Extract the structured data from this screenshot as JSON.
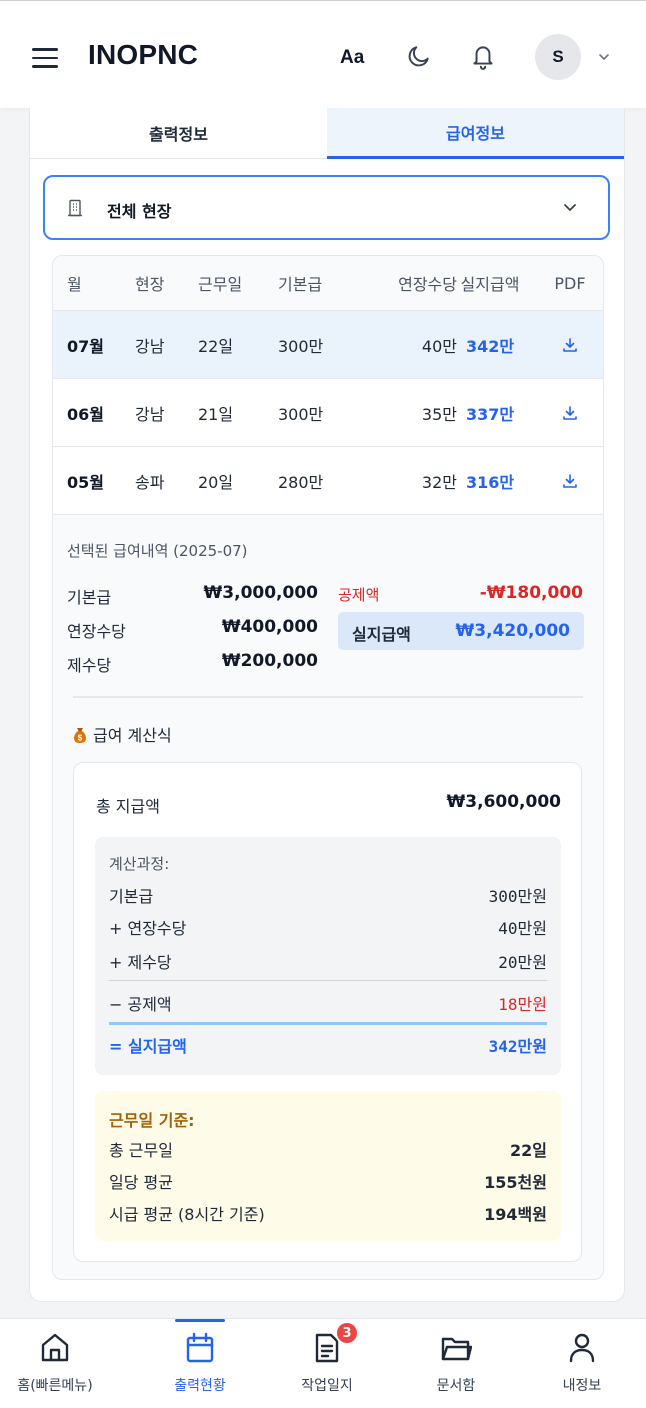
{
  "header": {
    "brand": "INOPNC",
    "font_toggle": "Aa",
    "avatar_initial": "S"
  },
  "tabs": [
    {
      "label": "출력정보",
      "active": false
    },
    {
      "label": "급여정보",
      "active": true
    }
  ],
  "site_filter": {
    "value": "전체 현장"
  },
  "table": {
    "headers": [
      "월",
      "현장",
      "근무일",
      "기본급",
      "연장수당",
      "실지급액",
      "PDF"
    ],
    "rows": [
      {
        "month": "07월",
        "site": "강남",
        "days": "22일",
        "base": "300만",
        "overtime": "40만",
        "net": "342만",
        "selected": true
      },
      {
        "month": "06월",
        "site": "강남",
        "days": "21일",
        "base": "300만",
        "overtime": "35만",
        "net": "337만",
        "selected": false
      },
      {
        "month": "05월",
        "site": "송파",
        "days": "20일",
        "base": "280만",
        "overtime": "32만",
        "net": "316만",
        "selected": false
      }
    ]
  },
  "detail": {
    "title": "선택된 급여내역 (2025-07)",
    "base_label": "기본급",
    "base_value": "₩3,000,000",
    "overtime_label": "연장수당",
    "overtime_value": "₩400,000",
    "allowance_label": "제수당",
    "allowance_value": "₩200,000",
    "deduction_label": "공제액",
    "deduction_value": "-₩180,000",
    "net_label": "실지급액",
    "net_value": "₩3,420,000"
  },
  "calc": {
    "title": "급여 계산식",
    "total_label": "총 지급액",
    "total_value": "₩3,600,000",
    "process_title": "계산과정:",
    "process_rows": [
      {
        "label": "기본급",
        "value": "300만원"
      },
      {
        "label": "+ 연장수당",
        "value": "40만원"
      },
      {
        "label": "+ 제수당",
        "value": "20만원"
      },
      {
        "label": "− 공제액",
        "value": "18만원"
      },
      {
        "label": "= 실지급액",
        "value": "342만원"
      }
    ],
    "basis_title": "근무일 기준:",
    "basis_rows": [
      {
        "label": "총 근무일",
        "value": "22일"
      },
      {
        "label": "일당 평균",
        "value": "155천원"
      },
      {
        "label": "시급 평균 (8시간 기준)",
        "value": "194백원"
      }
    ]
  },
  "bottom_nav": [
    {
      "label": "홈(빠른메뉴)",
      "icon": "home-icon",
      "active": false
    },
    {
      "label": "출력현황",
      "icon": "calendar-icon",
      "active": true
    },
    {
      "label": "작업일지",
      "icon": "document-icon",
      "active": false,
      "badge": "3"
    },
    {
      "label": "문서함",
      "icon": "folder-icon",
      "active": false
    },
    {
      "label": "내정보",
      "icon": "user-icon",
      "active": false
    }
  ],
  "colors": {
    "accent": "#2563eb",
    "danger": "#dc2626",
    "warning_text": "#a16207"
  }
}
